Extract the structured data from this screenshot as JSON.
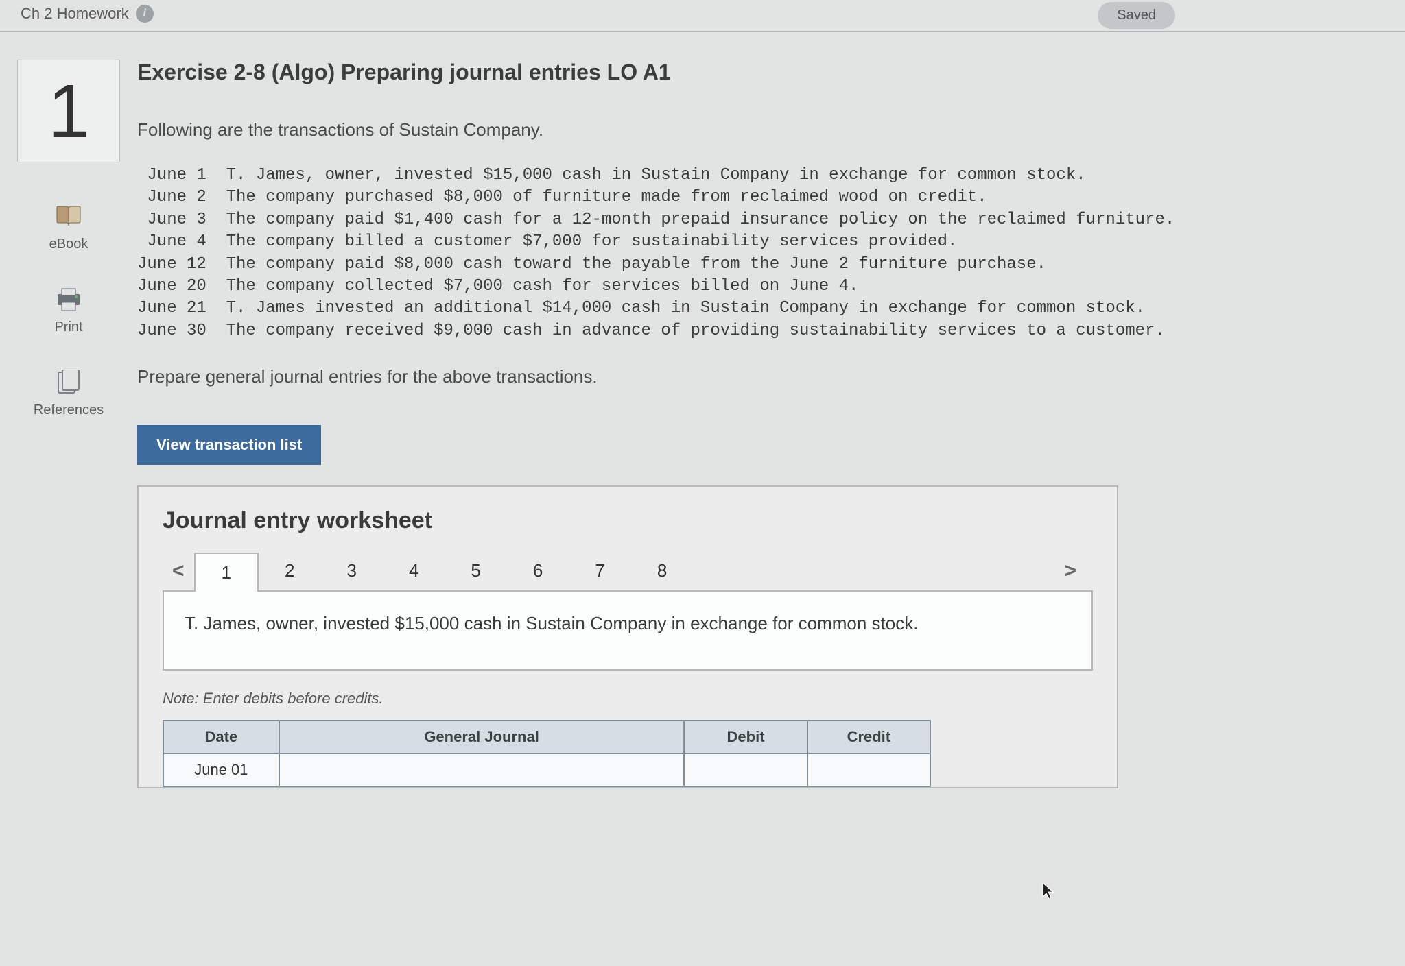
{
  "header": {
    "title": "Ch 2 Homework",
    "info_glyph": "i",
    "saved_label": "Saved"
  },
  "question_number": "1",
  "rail": {
    "ebook": "eBook",
    "print": "Print",
    "references": "References"
  },
  "exercise_title": "Exercise 2-8 (Algo) Preparing journal entries LO A1",
  "intro": "Following are the transactions of Sustain Company.",
  "transactions_block": " June 1  T. James, owner, invested $15,000 cash in Sustain Company in exchange for common stock.\n June 2  The company purchased $8,000 of furniture made from reclaimed wood on credit.\n June 3  The company paid $1,400 cash for a 12-month prepaid insurance policy on the reclaimed furniture.\n June 4  The company billed a customer $7,000 for sustainability services provided.\nJune 12  The company paid $8,000 cash toward the payable from the June 2 furniture purchase.\nJune 20  The company collected $7,000 cash for services billed on June 4.\nJune 21  T. James invested an additional $14,000 cash in Sustain Company in exchange for common stock.\nJune 30  The company received $9,000 cash in advance of providing sustainability services to a customer.",
  "instruction": "Prepare general journal entries for the above transactions.",
  "view_btn_label": "View transaction list",
  "worksheet": {
    "title": "Journal entry worksheet",
    "prev_glyph": "<",
    "next_glyph": ">",
    "tabs": [
      "1",
      "2",
      "3",
      "4",
      "5",
      "6",
      "7",
      "8"
    ],
    "active_tab_index": 0,
    "entry_description": "T. James, owner, invested $15,000 cash in Sustain Company in exchange for common stock.",
    "note": "Note: Enter debits before credits.",
    "columns": {
      "date": "Date",
      "general_journal": "General Journal",
      "debit": "Debit",
      "credit": "Credit"
    },
    "row1_date": "June 01"
  }
}
